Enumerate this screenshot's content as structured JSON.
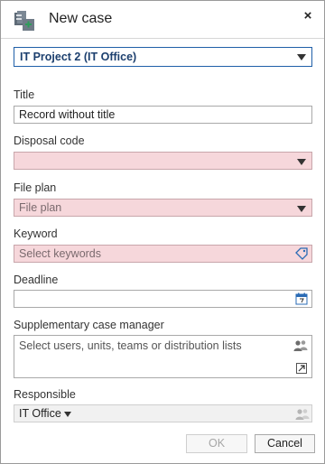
{
  "dialog": {
    "title": "New case",
    "close_label": "×",
    "app_icon": "case-folder-icon"
  },
  "project": {
    "value": "IT Project 2 (IT Office)"
  },
  "fields": {
    "title": {
      "label": "Title",
      "value": "Record without title"
    },
    "disposal_code": {
      "label": "Disposal code",
      "value": ""
    },
    "file_plan": {
      "label": "File plan",
      "placeholder": "File plan"
    },
    "keyword": {
      "label": "Keyword",
      "placeholder": "Select keywords",
      "icon": "tag-icon"
    },
    "deadline": {
      "label": "Deadline",
      "value": "",
      "icon": "calendar-icon"
    },
    "supplementary": {
      "label": "Supplementary case manager",
      "placeholder": "Select users, units, teams or distribution lists",
      "icons": [
        "users-icon",
        "expand-icon"
      ]
    },
    "responsible": {
      "label": "Responsible",
      "value": "IT Office",
      "icon": "users-icon"
    }
  },
  "buttons": {
    "ok": "OK",
    "cancel": "Cancel"
  },
  "colors": {
    "required_bg": "#f6d7db",
    "accent": "#1f5fa8",
    "disabled_bg": "#f1f1f1"
  }
}
